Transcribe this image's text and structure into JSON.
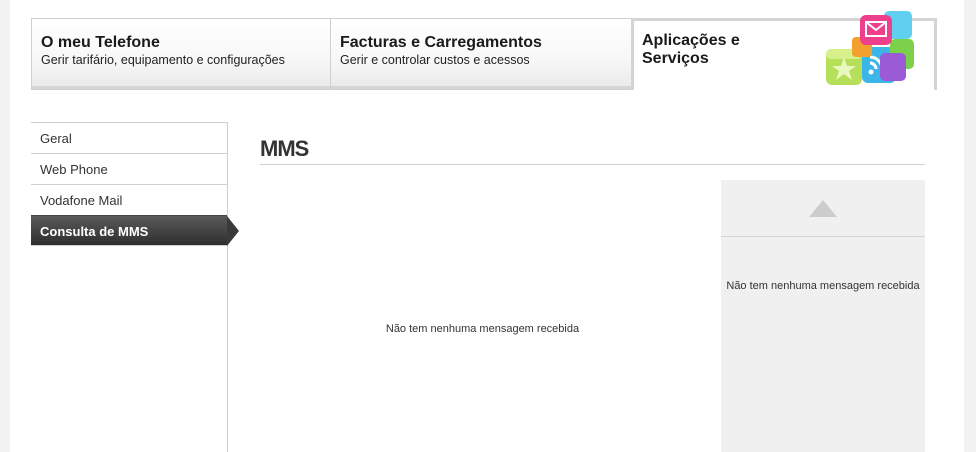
{
  "tabs": [
    {
      "title": "O meu Telefone",
      "subtitle": "Gerir tarifário, equipamento e configurações"
    },
    {
      "title": "Facturas e Carregamentos",
      "subtitle": "Gerir e controlar custos e acessos"
    },
    {
      "title": "Aplicações e Serviços",
      "icon": "apps-stack-icon"
    }
  ],
  "sidebar": {
    "items": [
      {
        "label": "Geral"
      },
      {
        "label": "Web Phone"
      },
      {
        "label": "Vodafone Mail"
      },
      {
        "label": "Consulta de MMS",
        "active": true
      }
    ]
  },
  "main": {
    "title": "MMS",
    "empty_message": "Não tem nenhuma mensagem recebida"
  },
  "right_panel": {
    "scroll_icon": "triangle-up-icon",
    "empty_message": "Não tem nenhuma mensagem recebida"
  }
}
